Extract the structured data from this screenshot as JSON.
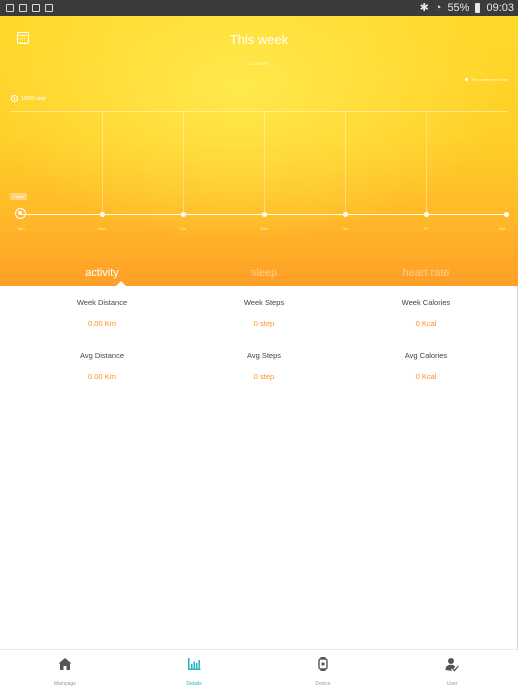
{
  "status_bar": {
    "battery": "55%",
    "time": "09:03"
  },
  "header": {
    "title": "This week",
    "subtitle": "2021/06/07",
    "legend": "The number of steps",
    "target": "10000 step",
    "zero": "0 step"
  },
  "chart_data": {
    "type": "line",
    "categories": [
      "Sun",
      "Mon",
      "Tue",
      "Wed",
      "Thu",
      "Fri",
      "Sat"
    ],
    "values": [
      0,
      0,
      0,
      0,
      0,
      0,
      0
    ]
  },
  "tabs": [
    {
      "label": "activity"
    },
    {
      "label": "sleep"
    },
    {
      "label": "heart rate"
    }
  ],
  "stats": {
    "week_distance_label": "Week Distance",
    "week_distance_value": "0.00 Km",
    "week_steps_label": "Week Steps",
    "week_steps_value": "0 step",
    "week_calories_label": "Week Calories",
    "week_calories_value": "0 Kcal",
    "avg_distance_label": "Avg Distance",
    "avg_distance_value": "0.00 Km",
    "avg_steps_label": "Avg Steps",
    "avg_steps_value": "0 step",
    "avg_calories_label": "Avg Calories",
    "avg_calories_value": "0 Kcal"
  },
  "nav": {
    "items": [
      {
        "label": "Mainpage"
      },
      {
        "label": "Details"
      },
      {
        "label": "Device"
      },
      {
        "label": "User"
      }
    ]
  },
  "colors": {
    "accent": "#ff8f1f",
    "active_nav": "#27b7c3"
  }
}
